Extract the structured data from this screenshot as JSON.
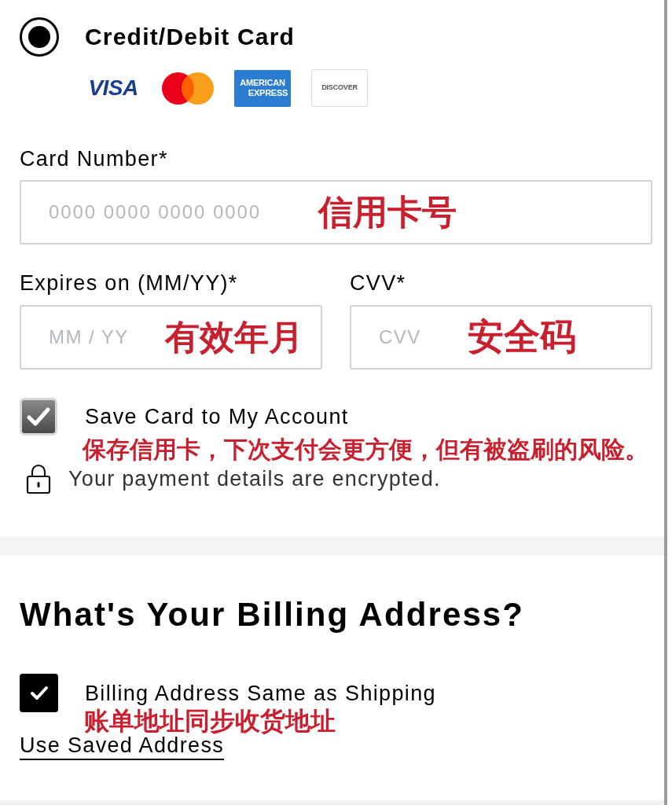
{
  "payment_method": {
    "label": "Credit/Debit Card",
    "selected": true
  },
  "card_brands": [
    {
      "kind": "visa",
      "label": "VISA"
    },
    {
      "kind": "mastercard"
    },
    {
      "kind": "amex",
      "lines": [
        "AMERICAN",
        "EXPRESS"
      ]
    },
    {
      "kind": "discover",
      "label": "DISCOVER"
    }
  ],
  "card_number": {
    "label": "Card Number*",
    "placeholder": "0000 0000 0000 0000",
    "annotation": "信用卡号"
  },
  "expiry": {
    "label": "Expires on (MM/YY)*",
    "placeholder": "MM / YY",
    "annotation": "有效年月"
  },
  "cvv": {
    "label": "CVV*",
    "placeholder": "CVV",
    "annotation": "安全码"
  },
  "save_card": {
    "label": "Save Card to My Account",
    "checked": true,
    "annotation": "保存信用卡，下次支付会更方便，但有被盗刷的风险。"
  },
  "security_note": "Your payment details are encrypted.",
  "billing": {
    "heading": "What's Your Billing Address?",
    "same_as_shipping": {
      "label": "Billing Address Same as Shipping",
      "checked": true,
      "annotation": "账单地址同步收货地址"
    },
    "link": "Use Saved Address"
  }
}
